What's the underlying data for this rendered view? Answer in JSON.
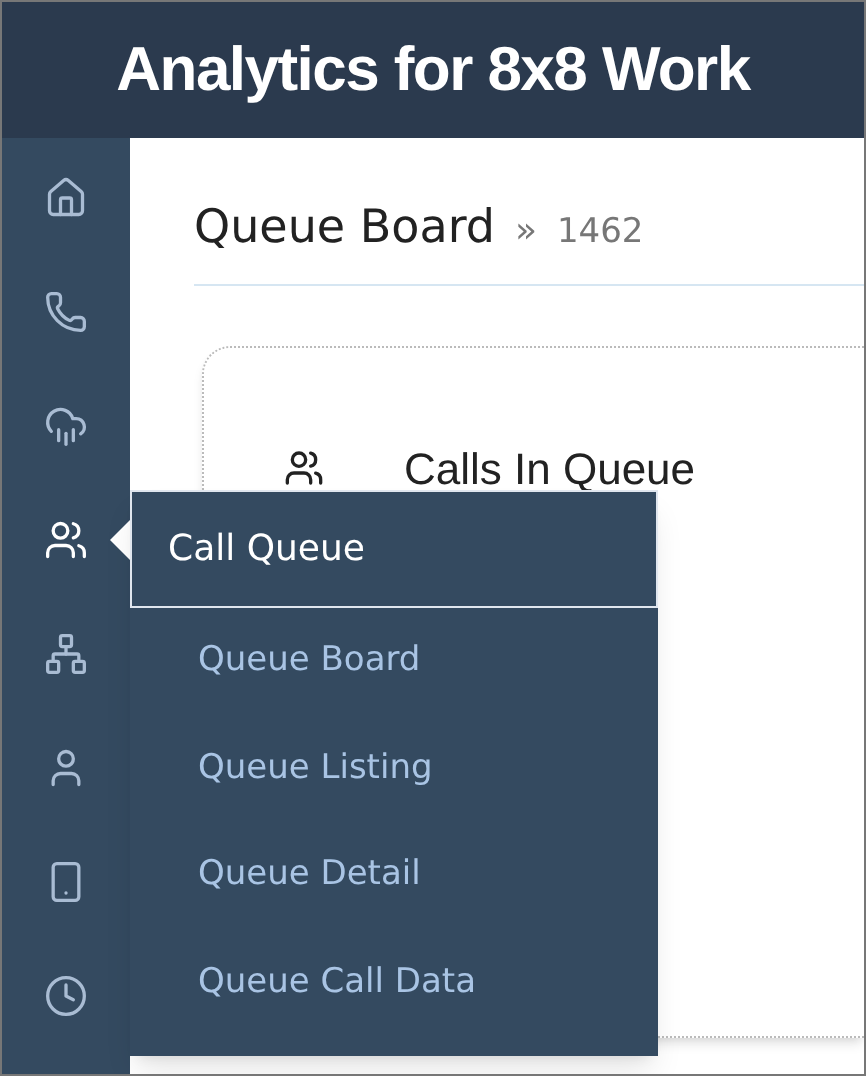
{
  "header": {
    "title": "Analytics for **8x8** Work"
  },
  "sidebar": {
    "items": [
      {
        "kind": "home",
        "selected": false
      },
      {
        "kind": "phone",
        "selected": false
      },
      {
        "kind": "cloud",
        "selected": false
      },
      {
        "kind": "queue",
        "selected": true
      },
      {
        "kind": "network",
        "selected": false
      },
      {
        "kind": "user",
        "selected": false
      },
      {
        "kind": "mobile",
        "selected": false
      },
      {
        "kind": "clock",
        "selected": false
      }
    ]
  },
  "page": {
    "title": "Queue Board",
    "separator": "»",
    "queue_id": "1462"
  },
  "card": {
    "title": "Calls In Queue"
  },
  "flyout": {
    "title": "Call Queue",
    "items": [
      "Queue Board",
      "Queue Listing",
      "Queue Detail",
      "Queue Call Data"
    ]
  }
}
